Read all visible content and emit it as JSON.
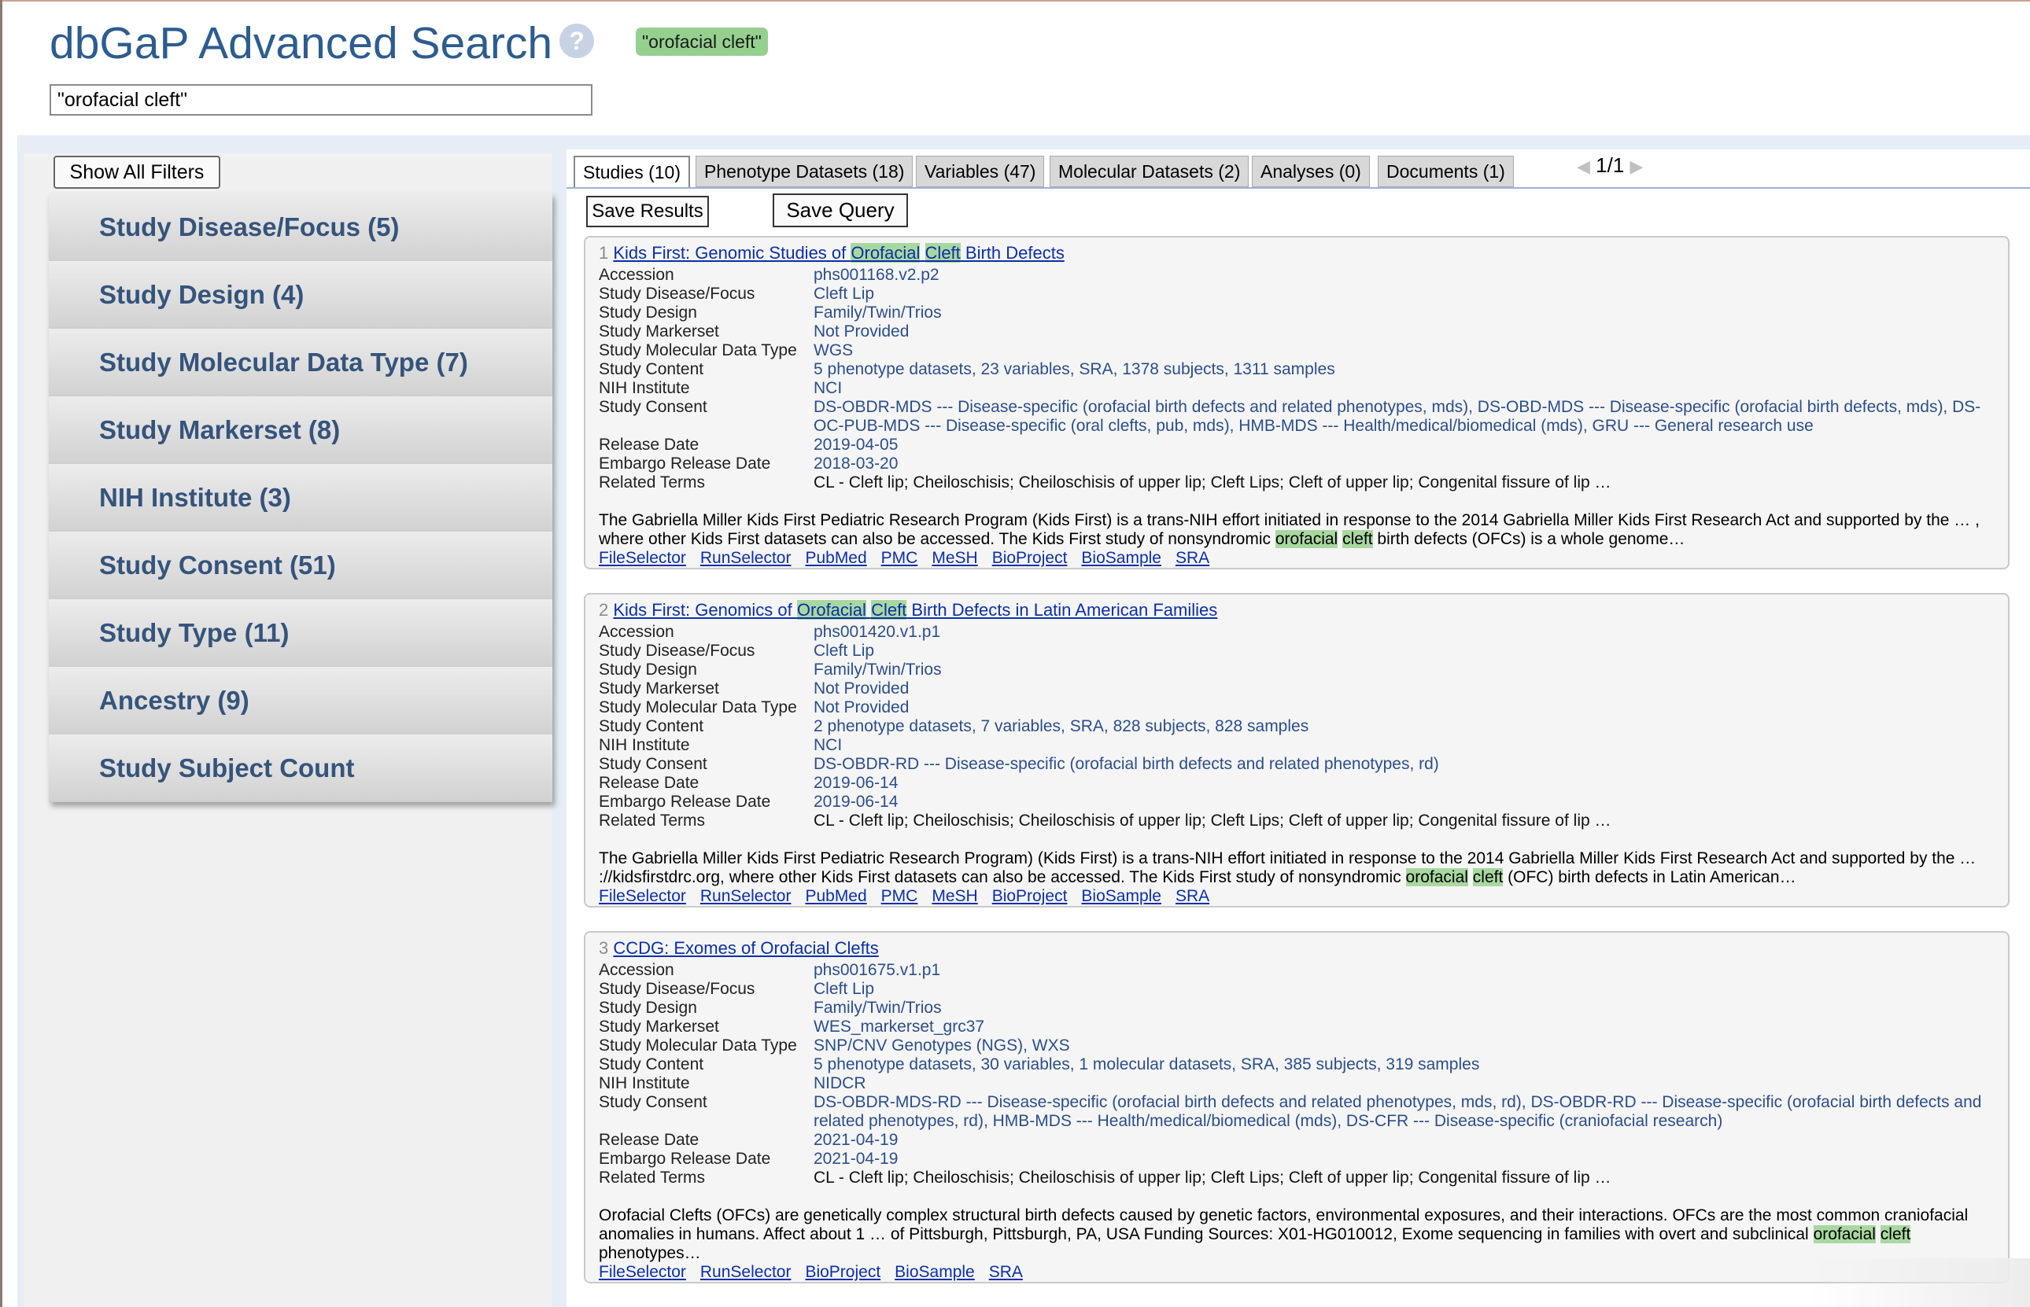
{
  "header": {
    "title": "dbGaP Advanced Search",
    "help_glyph": "?",
    "query_badge": "\"orofacial cleft\"",
    "search_value": "\"orofacial cleft\""
  },
  "filters": {
    "show_all_label": "Show All Filters",
    "items": [
      "Study Disease/Focus (5)",
      "Study Design (4)",
      "Study Molecular Data Type (7)",
      "Study Markerset (8)",
      "NIH Institute (3)",
      "Study Consent (51)",
      "Study Type (11)",
      "Ancestry (9)",
      "Study Subject Count"
    ]
  },
  "tabs": [
    {
      "label": "Studies (10)",
      "active": true
    },
    {
      "label": "Phenotype Datasets (18)",
      "active": false
    },
    {
      "label": "Variables (47)",
      "active": false
    },
    {
      "label": "Molecular Datasets (2)",
      "active": false
    },
    {
      "label": "Analyses (0)",
      "active": false
    },
    {
      "label": "Documents (1)",
      "active": false
    }
  ],
  "pager": {
    "prev": "◀",
    "page": "1/1",
    "next": "▶"
  },
  "actions": {
    "save_results": "Save Results",
    "save_query": "Save Query"
  },
  "field_labels": {
    "accession": "Accession",
    "disease": "Study Disease/Focus",
    "design": "Study Design",
    "markerset": "Study Markerset",
    "moltype": "Study Molecular Data Type",
    "content": "Study Content",
    "institute": "NIH Institute",
    "consent": "Study Consent",
    "release": "Release Date",
    "embargo": "Embargo Release Date",
    "related": "Related Terms"
  },
  "results": [
    {
      "num": "1",
      "title_pre": "Kids First: Genomic Studies of ",
      "title_hl1": "Orofacial",
      "title_hl2": "Cleft",
      "title_post": " Birth Defects",
      "accession": "phs001168.v2.p2",
      "disease": "Cleft Lip",
      "design": "Family/Twin/Trios",
      "markerset": "Not Provided",
      "moltype": "WGS",
      "content": "5 phenotype datasets, 23 variables, SRA, 1378 subjects, 1311 samples",
      "institute": "NCI",
      "consent": "DS-OBDR-MDS --- Disease-specific (orofacial birth defects and related phenotypes, mds), DS-OBD-MDS --- Disease-specific (orofacial birth defects, mds), DS-OC-PUB-MDS --- Disease-specific (oral clefts, pub, mds), HMB-MDS --- Health/medical/biomedical (mds), GRU --- General research use",
      "release": "2019-04-05",
      "embargo": "2018-03-20",
      "related": "CL - Cleft lip; Cheiloschisis; Cheiloschisis of upper lip; Cleft Lips; Cleft of upper lip; Congenital fissure of lip …",
      "desc_pre": "The Gabriella Miller Kids First Pediatric Research Program (Kids First) is a trans-NIH effort initiated in response to the 2014 Gabriella Miller Kids First Research Act and supported by the … , where other Kids First datasets can also be accessed. The Kids First study of nonsyndromic ",
      "desc_hl1": "orofacial",
      "desc_hl2": "cleft",
      "desc_post": " birth defects (OFCs) is a whole genome…",
      "links": [
        "FileSelector",
        "RunSelector",
        "PubMed",
        "PMC",
        "MeSH",
        "BioProject",
        "BioSample",
        "SRA"
      ]
    },
    {
      "num": "2",
      "title_pre": "Kids First: Genomics of ",
      "title_hl1": "Orofacial",
      "title_hl2": "Cleft",
      "title_post": " Birth Defects in Latin American Families",
      "accession": "phs001420.v1.p1",
      "disease": "Cleft Lip",
      "design": "Family/Twin/Trios",
      "markerset": "Not Provided",
      "moltype": "Not Provided",
      "content": "2 phenotype datasets, 7 variables, SRA, 828 subjects, 828 samples",
      "institute": "NCI",
      "consent": "DS-OBDR-RD --- Disease-specific (orofacial birth defects and related phenotypes, rd)",
      "release": "2019-06-14",
      "embargo": "2019-06-14",
      "related": "CL - Cleft lip; Cheiloschisis; Cheiloschisis of upper lip; Cleft Lips; Cleft of upper lip; Congenital fissure of lip …",
      "desc_pre": "The Gabriella Miller Kids First Pediatric Research Program) (Kids First) is a trans-NIH effort initiated in response to the 2014 Gabriella Miller Kids First Research Act and supported by the … ://kidsfirstdrc.org, where other Kids First datasets can also be accessed. The Kids First study of nonsyndromic ",
      "desc_hl1": "orofacial",
      "desc_hl2": "cleft",
      "desc_post": " (OFC) birth defects in Latin American…",
      "links": [
        "FileSelector",
        "RunSelector",
        "PubMed",
        "PMC",
        "MeSH",
        "BioProject",
        "BioSample",
        "SRA"
      ]
    },
    {
      "num": "3",
      "title_pre": "CCDG: Exomes of Orofacial Clefts",
      "title_hl1": "",
      "title_hl2": "",
      "title_post": "",
      "accession": "phs001675.v1.p1",
      "disease": "Cleft Lip",
      "design": "Family/Twin/Trios",
      "markerset": "WES_markerset_grc37",
      "moltype": "SNP/CNV Genotypes (NGS), WXS",
      "content": "5 phenotype datasets, 30 variables, 1 molecular datasets, SRA, 385 subjects, 319 samples",
      "institute": "NIDCR",
      "consent": "DS-OBDR-MDS-RD --- Disease-specific (orofacial birth defects and related phenotypes, mds, rd), DS-OBDR-RD --- Disease-specific (orofacial birth defects and related phenotypes, rd), HMB-MDS --- Health/medical/biomedical (mds), DS-CFR --- Disease-specific (craniofacial research)",
      "release": "2021-04-19",
      "embargo": "2021-04-19",
      "related": "CL - Cleft lip; Cheiloschisis; Cheiloschisis of upper lip; Cleft Lips; Cleft of upper lip; Congenital fissure of lip …",
      "desc_pre": "Orofacial Clefts (OFCs) are genetically complex structural birth defects caused by genetic factors, environmental exposures, and their interactions. OFCs are the most common craniofacial anomalies in humans. Affect about 1 … of Pittsburgh, Pittsburgh, PA, USA Funding Sources: X01-HG010012, Exome sequencing in families with overt and subclinical ",
      "desc_hl1": "orofacial",
      "desc_hl2": "cleft",
      "desc_post": " phenotypes…",
      "links": [
        "FileSelector",
        "RunSelector",
        "BioProject",
        "BioSample",
        "SRA"
      ]
    }
  ]
}
